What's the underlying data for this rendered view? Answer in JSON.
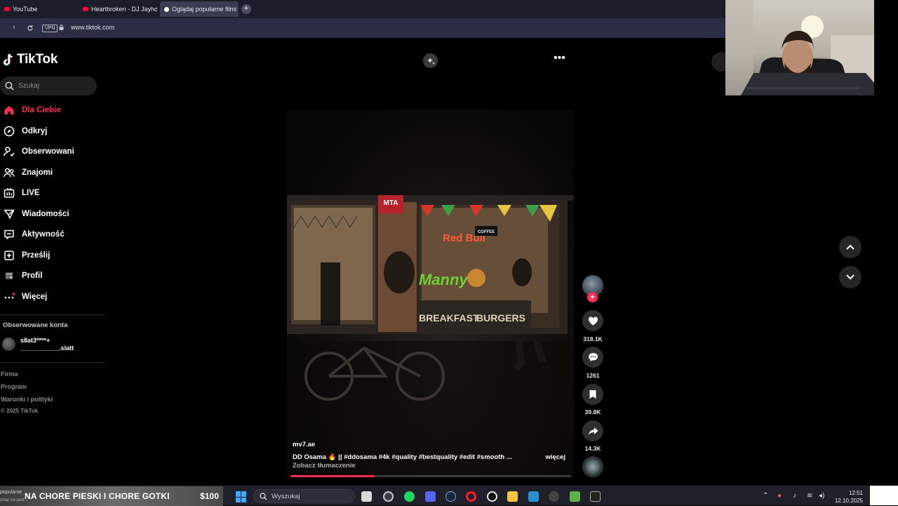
{
  "browser": {
    "tabs": [
      {
        "label": "YouTube"
      },
      {
        "label": "Heartbroken - DJ Jayhood"
      },
      {
        "label": "Oglądaj popularne filmi"
      }
    ],
    "new_tab": "+",
    "vpn": "VPN",
    "url": "www.tiktok.com"
  },
  "sidebar": {
    "logo": "TikTok",
    "search_placeholder": "Szukaj",
    "items": [
      {
        "label": "Dla Ciebie",
        "icon": "home-icon",
        "active": true
      },
      {
        "label": "Odkryj",
        "icon": "compass-icon"
      },
      {
        "label": "Obserwowani",
        "icon": "user-follow-icon"
      },
      {
        "label": "Znajomi",
        "icon": "friends-icon"
      },
      {
        "label": "LIVE",
        "icon": "live-icon"
      },
      {
        "label": "Wiadomości",
        "icon": "messages-icon"
      },
      {
        "label": "Aktywność",
        "icon": "activity-icon"
      },
      {
        "label": "Prześlij",
        "icon": "upload-icon"
      },
      {
        "label": "Profil",
        "icon": "profile-icon"
      },
      {
        "label": "Więcej",
        "icon": "more-icon"
      }
    ],
    "followed_title": "Obserwowane konta",
    "followed_account": {
      "username": "s8at3****+",
      "nickname": "___________.slatt"
    },
    "footer": [
      "Firma",
      "Program",
      "Warunki i polityki",
      "© 2025 TikTok"
    ]
  },
  "video": {
    "username": "mv7.ae",
    "description": "DD Osama 🔥 || #ddosama #4k #quality #bestquality #edit #smooth ...",
    "more": "więcej",
    "translate": "Zobacz tłumaczenie",
    "progress": 0.3,
    "scene": {
      "sign_top": "MTA",
      "sign_redbull": "Red Bull",
      "sign_store": "Manny's",
      "sign_breakfast": "BREAKFAST",
      "sign_burgers": "BURGERS",
      "sign_coffee": "COFFEE"
    }
  },
  "actions": {
    "likes": "318.1K",
    "comments": "1261",
    "saves": "39.8K",
    "shares": "14.3K",
    "follow": "+"
  },
  "taskbar": {
    "ticker_sub1": "popularne",
    "ticker_sub2": "zmar ne pośl...",
    "ticker_text": "NA CHORE PIESKI I CHORE GOTKI",
    "ticker_amount": "$100",
    "search_text": "Wyszukaj",
    "time": "12:51",
    "date": "12.10.2025"
  },
  "colors": {
    "accent": "#fe2c55",
    "background": "#000000",
    "browser_bar": "#2a2d44"
  }
}
